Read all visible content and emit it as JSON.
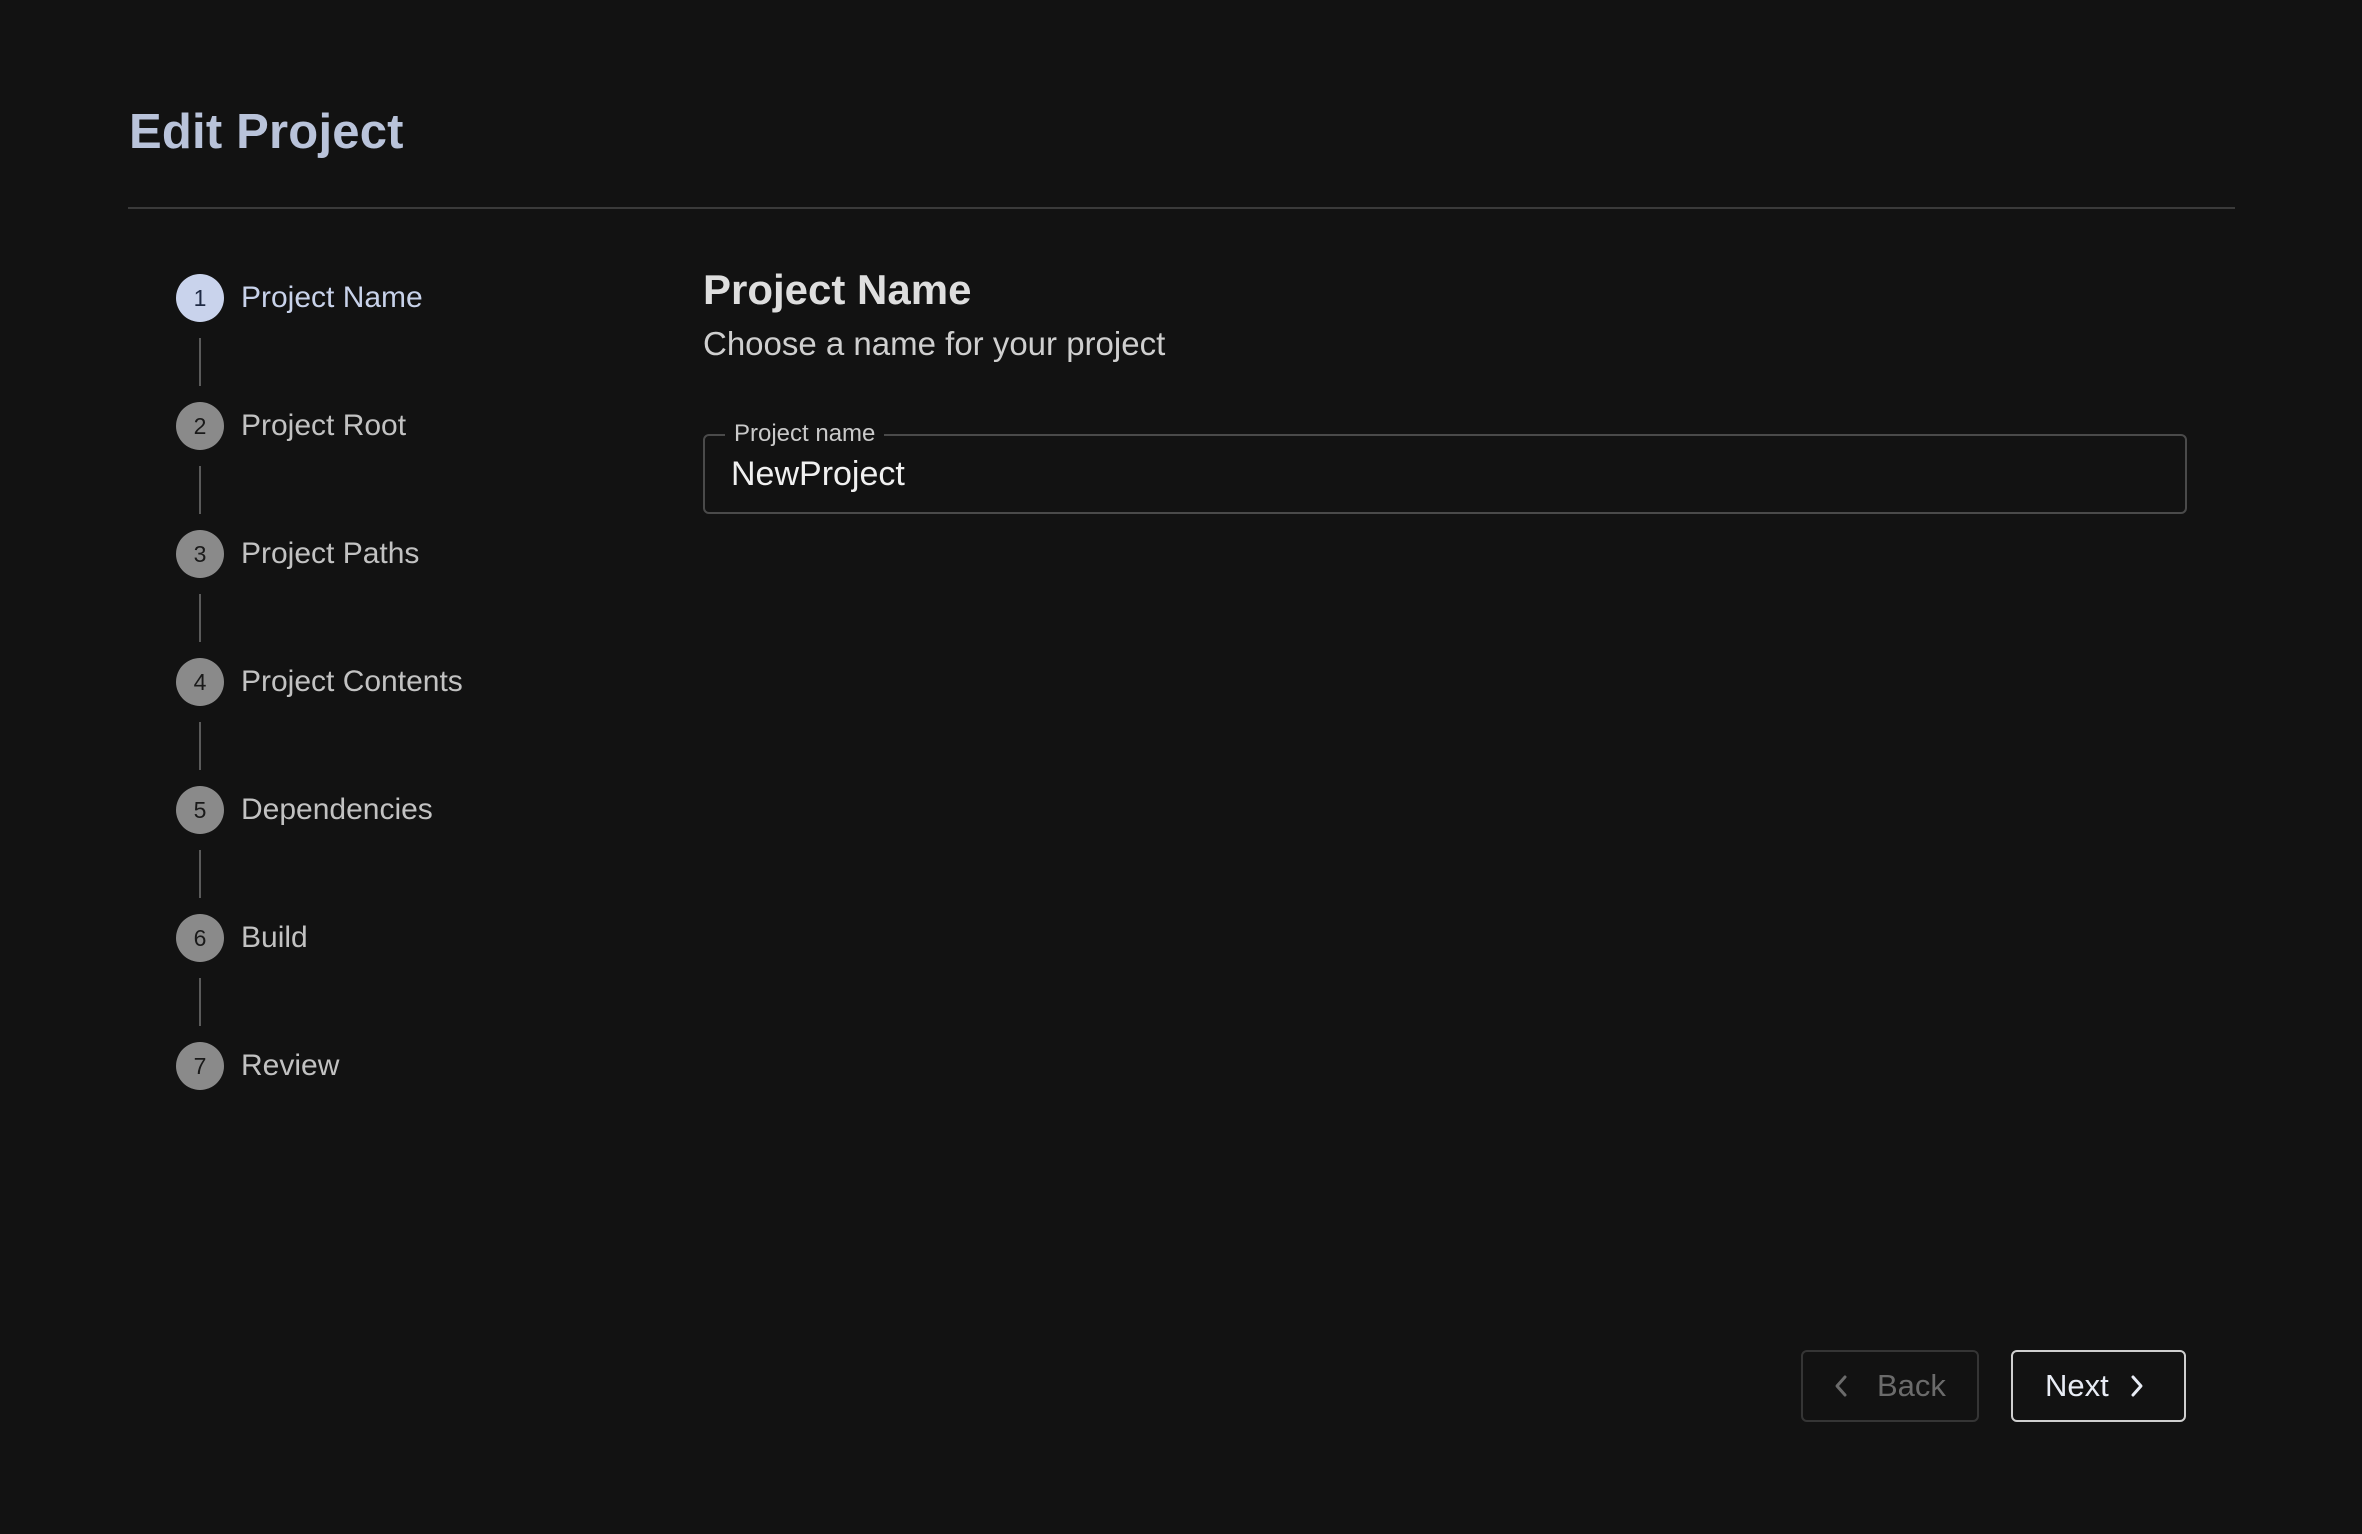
{
  "header": {
    "title": "Edit Project"
  },
  "stepper": {
    "steps": [
      {
        "number": "1",
        "label": "Project Name",
        "active": true
      },
      {
        "number": "2",
        "label": "Project Root",
        "active": false
      },
      {
        "number": "3",
        "label": "Project Paths",
        "active": false
      },
      {
        "number": "4",
        "label": "Project Contents",
        "active": false
      },
      {
        "number": "5",
        "label": "Dependencies",
        "active": false
      },
      {
        "number": "6",
        "label": "Build",
        "active": false
      },
      {
        "number": "7",
        "label": "Review",
        "active": false
      }
    ]
  },
  "main": {
    "section_title": "Project Name",
    "section_subtitle": "Choose a name for your project",
    "project_name_field": {
      "label": "Project name",
      "value": "NewProject"
    }
  },
  "footer": {
    "back_label": "Back",
    "back_enabled": false,
    "next_label": "Next",
    "back_icon": "chevron-left-icon",
    "next_icon": "chevron-right-icon"
  },
  "colors": {
    "background": "#121212",
    "accent": "#c9d3ec",
    "title": "#b9c3da"
  }
}
